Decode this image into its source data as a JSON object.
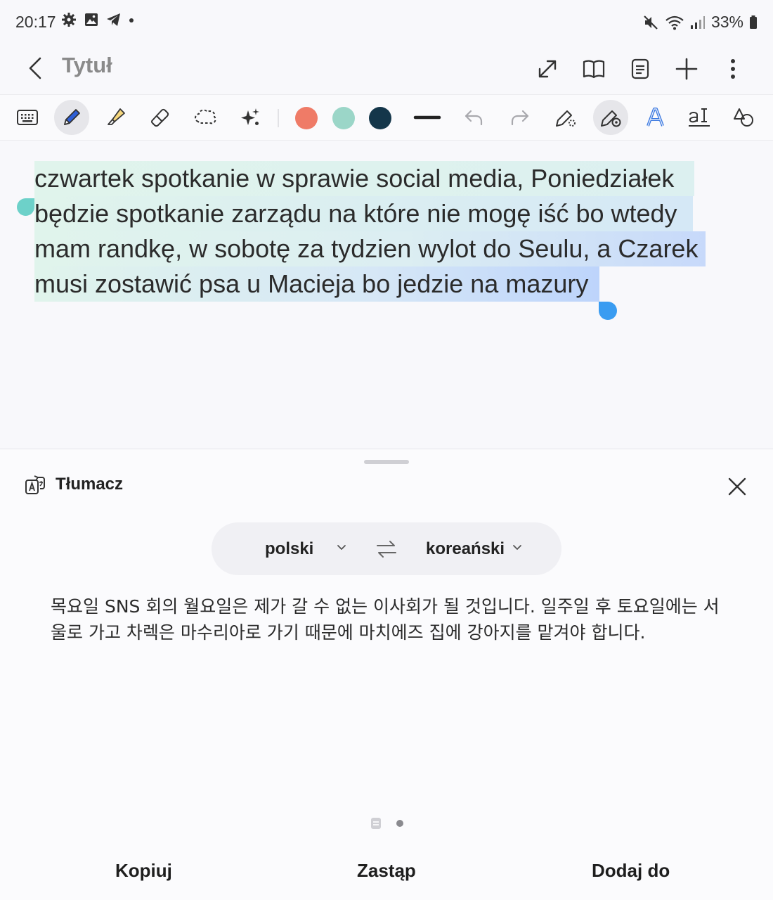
{
  "status_bar": {
    "time": "20:17",
    "left_icons": [
      "settings-icon",
      "gallery-icon",
      "telegram-icon",
      "dot-icon"
    ],
    "right_icons": [
      "mute-icon",
      "wifi-icon",
      "signal-icon",
      "battery-icon"
    ],
    "battery": "33%"
  },
  "title_bar": {
    "title": "Tytuł",
    "actions": [
      "expand-icon",
      "book-icon",
      "page-icon",
      "add-icon",
      "more-icon"
    ]
  },
  "toolbar": {
    "tools": [
      "keyboard-icon",
      "pen-icon",
      "highlighter-icon",
      "eraser-icon",
      "lasso-icon",
      "ai-sparkle-icon"
    ],
    "active_tool": "pen-icon",
    "colors": [
      "#ef7b67",
      "#9bd6c8",
      "#14364a"
    ],
    "extra": [
      "stroke-width-icon",
      "undo-icon",
      "redo-icon",
      "pen-settings-icon",
      "handwriting-assist-icon",
      "text-style-icon",
      "text-recognition-icon",
      "shapes-icon"
    ]
  },
  "note": {
    "lines": [
      "czwartek spotkanie w sprawie social media, Poniedziałek",
      "będzie spotkanie zarządu na które nie mogę iść bo wtedy",
      "mam randkę, w sobotę za tydzien wylot do Seulu, a Czarek",
      "musi zostawić psa u Macieja bo jedzie na mazury"
    ],
    "selection_gradient": [
      "#dff3ec",
      "#c9dbfb"
    ]
  },
  "translate_panel": {
    "title": "Tłumacz",
    "source_lang": "polski",
    "target_lang": "koreański",
    "translation": "목요일 SNS 회의 월요일은 제가 갈 수 없는 이사회가 될 것입니다. 일주일 후 토요일에는 서울로 가고 차렉은 마수리아로 가기 때문에 마치에즈 집에 강아지를 맡겨야 합니다.",
    "actions": {
      "copy": "Kopiuj",
      "replace": "Zastąp",
      "add_to": "Dodaj do"
    },
    "pages": 2,
    "current_page": 2
  }
}
